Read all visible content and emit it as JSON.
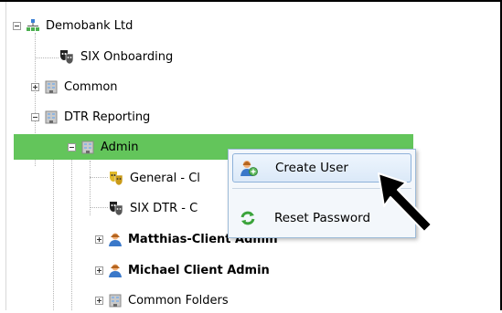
{
  "tree": {
    "root": {
      "label": "Demobank Ltd",
      "icon": "org-chart-icon"
    },
    "items": [
      {
        "label": "SIX Onboarding",
        "icon": "theater-mask-icon"
      },
      {
        "label": "Common",
        "icon": "building-icon"
      },
      {
        "label": "DTR Reporting",
        "icon": "building-icon"
      },
      {
        "label": "Admin",
        "icon": "building-icon",
        "selected": true
      },
      {
        "label": "General - Cl",
        "icon": "theater-mask-gold-icon"
      },
      {
        "label": "SIX DTR - C",
        "icon": "theater-mask-icon"
      },
      {
        "label": "Matthias-Client Admin",
        "icon": "user-icon"
      },
      {
        "label": "Michael Client Admin",
        "icon": "user-icon"
      },
      {
        "label": "Common Folders",
        "icon": "building-icon"
      }
    ]
  },
  "context_menu": {
    "items": [
      {
        "label": "Create User",
        "icon": "add-user-icon"
      },
      {
        "label": "Reset Password",
        "icon": "reset-arrow-icon"
      }
    ]
  },
  "colors": {
    "selection": "#63c55b",
    "menu_background": "#f3f7fb",
    "menu_border": "#9dbbd8"
  }
}
